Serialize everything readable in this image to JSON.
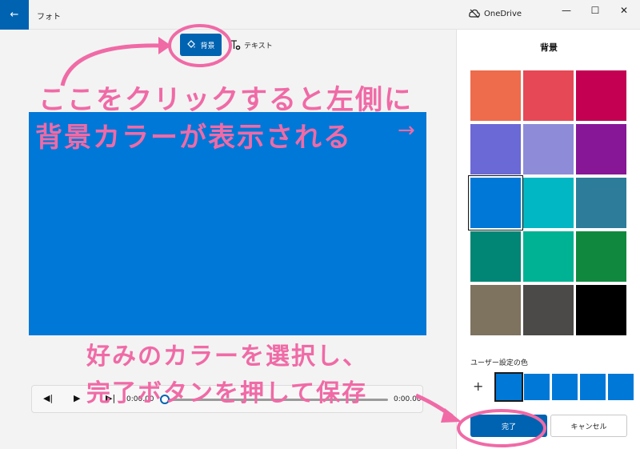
{
  "window": {
    "app_title": "フォト",
    "onedrive_label": "OneDrive",
    "back_icon": "←",
    "minimize_icon": "—",
    "maximize_icon": "☐",
    "close_icon": "✕"
  },
  "toolbar": {
    "background_label": "背景",
    "text_label": "テキスト"
  },
  "preview": {
    "background_color": "#0078d7"
  },
  "playback": {
    "prev_icon": "◀|",
    "play_icon": "▶",
    "next_icon": "▶|",
    "current_time": "0:00.00",
    "end_time": "0:00.00",
    "progress": 0
  },
  "panel": {
    "title": "背景",
    "swatches": [
      "#ee6b4c",
      "#e74856",
      "#c30052",
      "#6b69d6",
      "#8e8cd8",
      "#881798",
      "#0078d7",
      "#00b7c3",
      "#2d7d9a",
      "#018574",
      "#00b294",
      "#10893e",
      "#7e735f",
      "#4c4a48",
      "#000000"
    ],
    "selected_swatch": 6,
    "custom_label": "ユーザー設定の色",
    "plus_icon": "+",
    "custom_colors": [
      "#0078d7",
      "#0078d7",
      "#0078d7",
      "#0078d7",
      "#0078d7"
    ],
    "done_label": "完了",
    "cancel_label": "キャンセル"
  },
  "annotations": {
    "line1": "ここをクリックすると左側に",
    "line2": "背景カラーが表示される",
    "arrow": "→",
    "line3": "好みのカラーを選択し、",
    "line4": "完了ボタンを押して保存",
    "color": "#f06aa6"
  }
}
